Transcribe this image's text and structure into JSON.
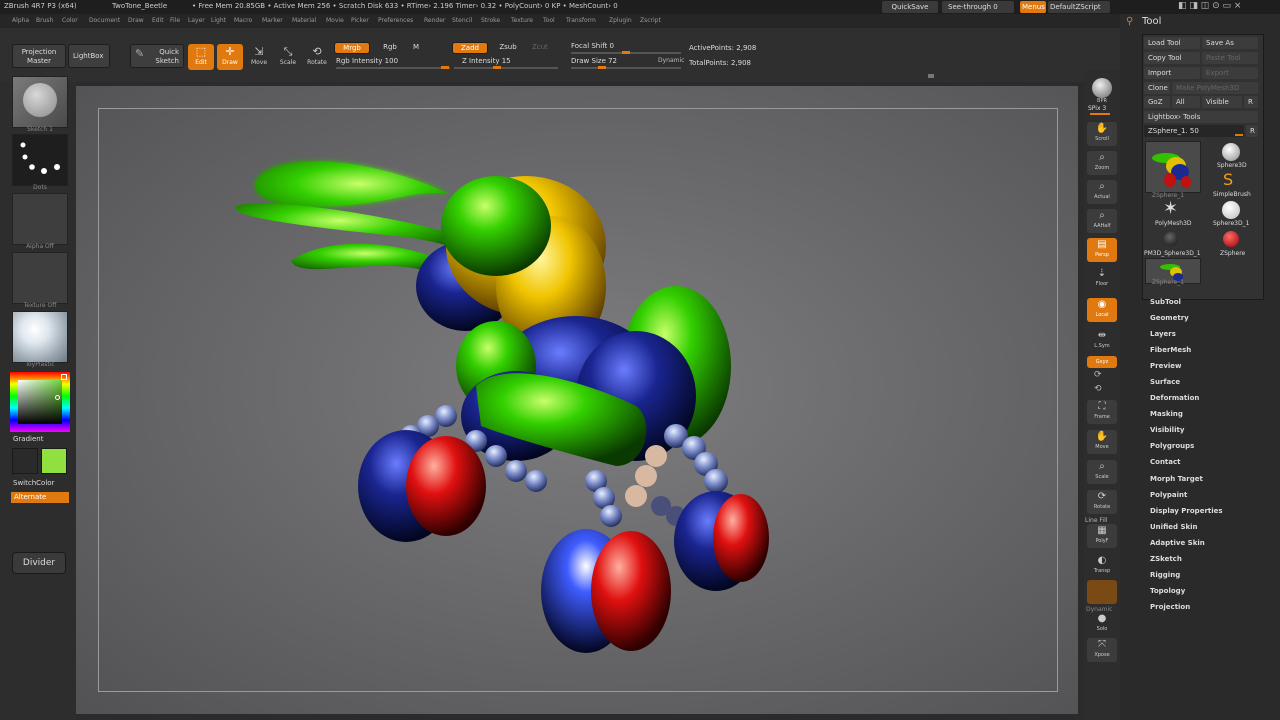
{
  "titlebar": {
    "app": "ZBrush 4R7 P3 (x64)",
    "doc": "TwoTone_Beetle",
    "stats": "• Free Mem 20.85GB • Active Mem 256 • Scratch Disk 633 • RTime› 2.196 Timer› 0.32 • PolyCount› 0 KP • MeshCount› 0",
    "quicksave": "QuickSave",
    "seethrough": "See-through  0",
    "menus": "Menus",
    "script": "DefaultZScript"
  },
  "menu": [
    "Alpha",
    "Brush",
    "Color",
    "Document",
    "Draw",
    "Edit",
    "File",
    "Layer",
    "Light",
    "Macro",
    "Marker",
    "Material",
    "Movie",
    "Picker",
    "Preferences",
    "Render",
    "Stencil",
    "Stroke",
    "Texture",
    "Tool",
    "Transform",
    "Zplugin",
    "Zscript"
  ],
  "shelf": {
    "projection_master": "Projection Master",
    "lightbox": "LightBox",
    "quick_sketch": "Quick Sketch",
    "edit": "Edit",
    "draw": "Draw",
    "move": "Move",
    "scale": "Scale",
    "rotate": "Rotate",
    "mrgb": "Mrgb",
    "rgb": "Rgb",
    "m": "M",
    "rgb_intensity": "Rgb Intensity 100",
    "zadd": "Zadd",
    "zsub": "Zsub",
    "zcut": "Zcut",
    "z_intensity": "Z Intensity 15",
    "focal_shift": "Focal Shift 0",
    "draw_size": "Draw Size 72",
    "dynamic": "Dynamic",
    "active_points": "ActivePoints: 2,908",
    "total_points": "TotalPoints: 2,908"
  },
  "lefttray": {
    "stroke": "Sketch 1",
    "brush": "Dots",
    "alpha": "Alpha Off",
    "texture": "Texture Off",
    "material": "ToyPlastic",
    "gradient": "Gradient",
    "switchcolor": "SwitchColor",
    "alternate": "Alternate",
    "divider": "Divider",
    "primary_color": "#90e040"
  },
  "righttray": {
    "bpr": "BPR",
    "spix": "SPix 3",
    "scroll": "Scroll",
    "zoom": "Zoom",
    "actual": "Actual",
    "aahalf": "AAHalf",
    "persp": "Persp",
    "floor": "Floor",
    "local": "Local",
    "lsym": "L.Sym",
    "xyz": "Gxyz",
    "frame": "Frame",
    "move": "Move",
    "scale": "Scale",
    "rotate": "Rotate",
    "linefill": "Line Fill",
    "polyf": "PolyF",
    "transp": "Transp",
    "ghost": "Ghost",
    "dynamic": "Dynamic",
    "solo": "Solo",
    "xpose": "Xpose"
  },
  "tool": {
    "title": "Tool",
    "load": "Load Tool",
    "saveas": "Save As",
    "copy": "Copy Tool",
    "paste": "Paste Tool",
    "import": "Import",
    "export": "Export",
    "clone": "Clone",
    "makepoly": "Make PolyMesh3D",
    "goz": "GoZ",
    "all": "All",
    "visible": "Visible",
    "r": "R",
    "lightbox_tools": "Lightbox› Tools",
    "current": "ZSphere_1. 50",
    "items": [
      "ZSphere_1",
      "Sphere3D",
      "SimpleBrush",
      "PolyMesh3D",
      "Sphere3D_1",
      "PM3D_Sphere3D_1",
      "ZSphere",
      "ZSphere_1"
    ],
    "subpalettes": [
      "SubTool",
      "Geometry",
      "Layers",
      "FiberMesh",
      "Preview",
      "Surface",
      "Deformation",
      "Masking",
      "Visibility",
      "Polygroups",
      "Contact",
      "Morph Target",
      "Polypaint",
      "Display Properties",
      "Unified Skin",
      "Adaptive Skin",
      "ZSketch",
      "Rigging",
      "Topology",
      "Projection"
    ]
  },
  "colors": {
    "accent": "#e07a10",
    "panel": "#2a2a2a"
  }
}
